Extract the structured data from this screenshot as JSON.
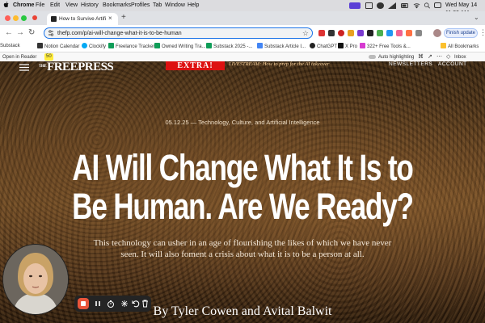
{
  "menubar": {
    "app": "Chrome",
    "items": [
      "File",
      "Edit",
      "View",
      "History",
      "Bookmarks",
      "Profiles",
      "Tab",
      "Window",
      "Help"
    ],
    "clock": "Wed May 14  11:39 AM"
  },
  "tabs": {
    "active_title": "How to Survive Artificial Intelligence"
  },
  "toolbar": {
    "url": "thefp.com/p/ai-will-change-what-it-is-to-be-human",
    "finish_update": "Finish update"
  },
  "bookmarks": {
    "items": [
      "Substack",
      "Notion Calendar",
      "Clockify",
      "Freelance Tracker",
      "Owned Writing Tra...",
      "Substack 2025 -...",
      "Substack Article I...",
      "ChatGPT",
      "X Pro",
      "322+ Free Tools &...",
      "All Bookmarks"
    ]
  },
  "readerbar": {
    "open_in_reader": "Open in Reader",
    "badge": "50",
    "auto_highlighting": "Auto highlighting",
    "inbox": "Inbox"
  },
  "site": {
    "logo_the": "THE",
    "logo": "FREEPRESS",
    "extra": "EXTRA!",
    "livestream": "LIVESTREAM: How to prep for the AI takeover",
    "nav_newsletters": "NEWSLETTERS",
    "nav_account": "ACCOUNT"
  },
  "article": {
    "dateline": "05.12.25 — Technology, Culture, and Artificial Intelligence",
    "headline": "AI Will Change What It Is to Be Human. Are We Ready?",
    "dek": "This technology can usher in an age of flourishing the likes of which we have never seen. It will also foment a crisis about what it is to be a person at all.",
    "byline": "By Tyler Cowen and Avital Balwit"
  },
  "colors": {
    "accent_blue": "#1a73e8",
    "extra_red": "#dd1111",
    "record_red": "#e8553a"
  }
}
